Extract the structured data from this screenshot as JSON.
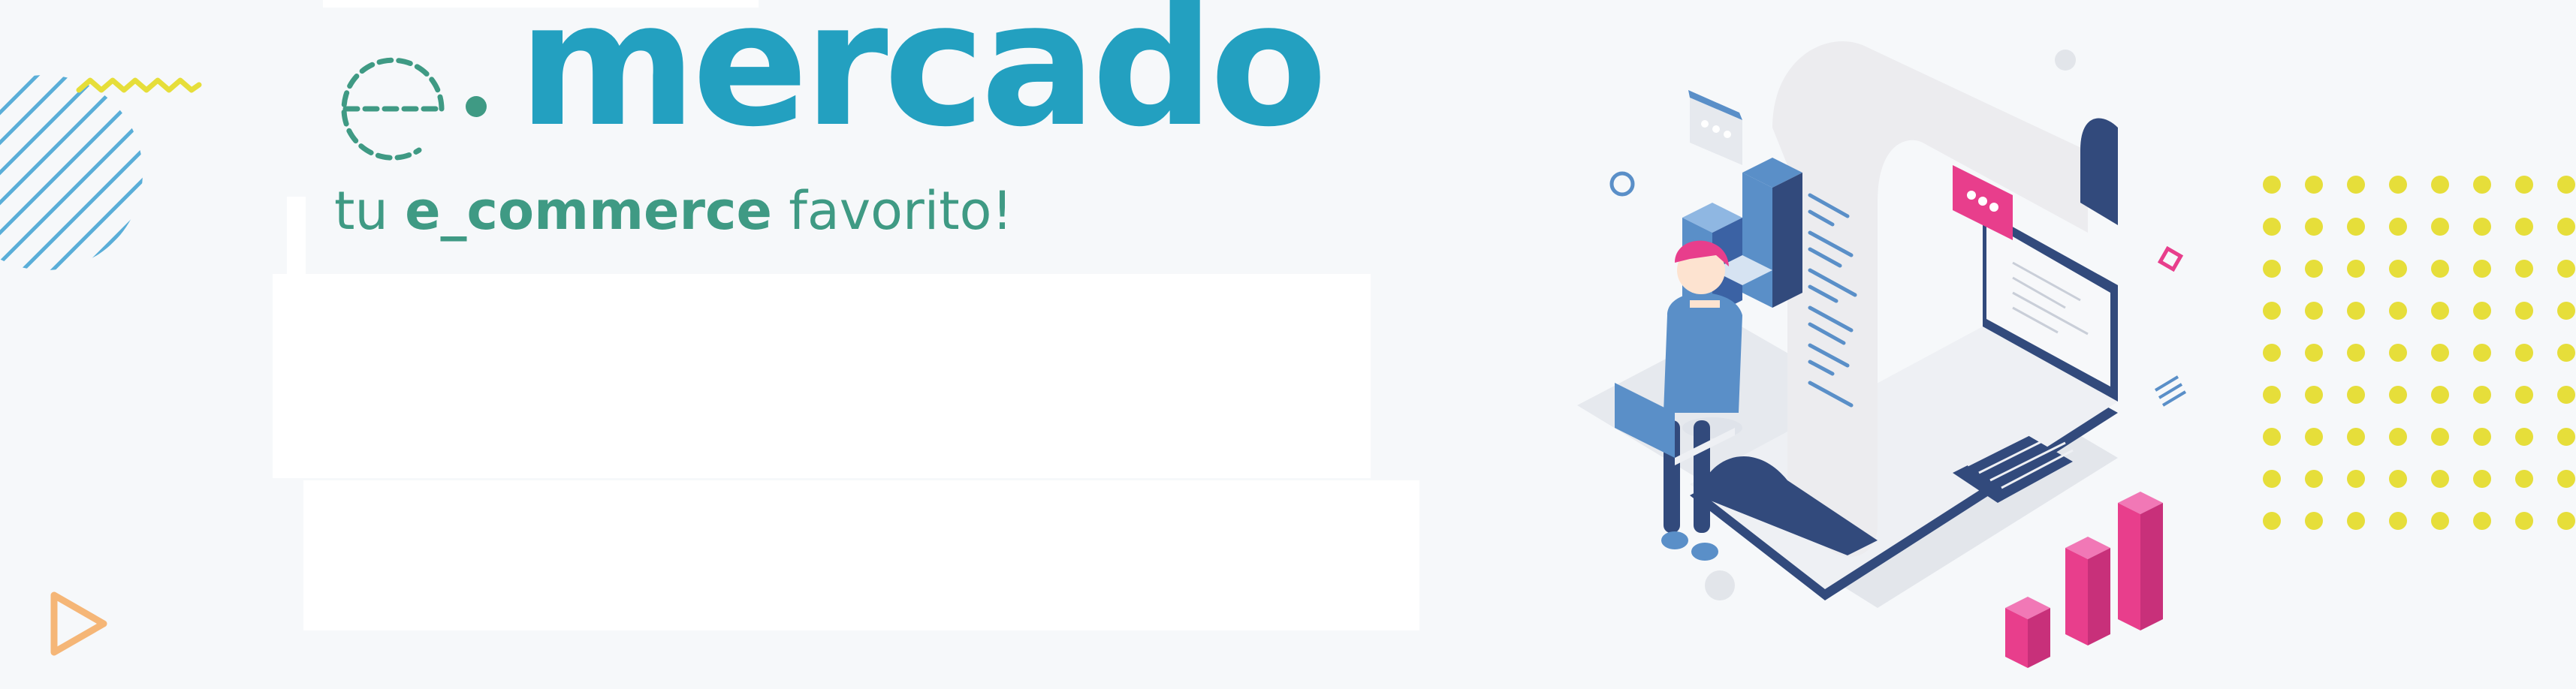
{
  "brand": {
    "logo_word": "mercado",
    "logo_mark_icon": "dashed-e-icon",
    "tagline_pre": "tu ",
    "tagline_bold": "e_commerce",
    "tagline_post": " favorito!",
    "colors": {
      "primary": "#23a0c0",
      "secondary": "#3f9a84",
      "accent_pink": "#e83e8c",
      "accent_yellow": "#e6de3a",
      "navy": "#324a7c",
      "background": "#f6f8fa"
    }
  },
  "decorations": {
    "left_blob_icon": "striped-circle-icon",
    "squiggle_icon": "zigzag-icon",
    "triangle_icon": "play-triangle-icon",
    "dot_grid_icon": "dot-grid-icon"
  },
  "illustration": {
    "icon": "person-laptop-receipt-icon"
  }
}
